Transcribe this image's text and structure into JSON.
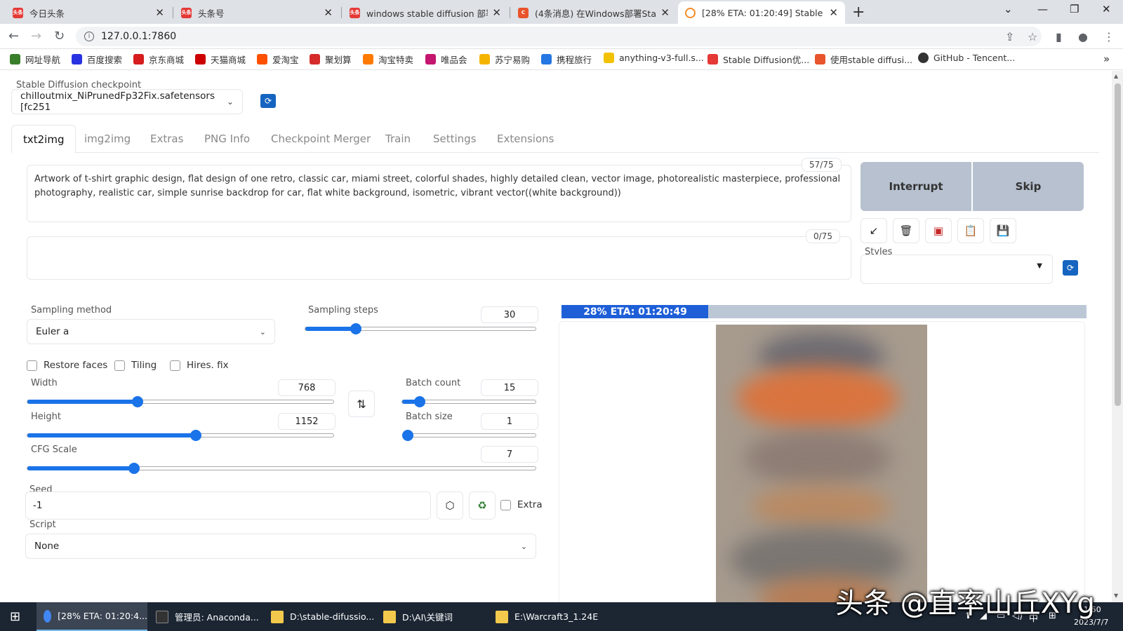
{
  "browser": {
    "tabs": [
      {
        "title": "今日头条",
        "icon_color": "#e53935",
        "icon_text": "头条"
      },
      {
        "title": "头条号",
        "icon_color": "#e53935",
        "icon_text": "头条"
      },
      {
        "title": "windows stable diffusion 部署",
        "icon_color": "#e53935",
        "icon_text": "头条"
      },
      {
        "title": "(4条消息) 在Windows部署Stabl",
        "icon_color": "#e8542c",
        "icon_text": "C"
      },
      {
        "title": "[28% ETA: 01:20:49] Stable Diff",
        "icon_color": "#f28c28",
        "icon_text": ""
      }
    ],
    "address": "127.0.0.1:7860",
    "bookmarks": [
      {
        "label": "网址导航",
        "color": "#3a7d2b"
      },
      {
        "label": "百度搜索",
        "color": "#2932e1"
      },
      {
        "label": "京东商城",
        "color": "#d71c1e"
      },
      {
        "label": "天猫商城",
        "color": "#cc0000"
      },
      {
        "label": "爱淘宝",
        "color": "#ff5000"
      },
      {
        "label": "聚划算",
        "color": "#d62b2b"
      },
      {
        "label": "淘宝特卖",
        "color": "#ff7a00"
      },
      {
        "label": "唯品会",
        "color": "#c5166f"
      },
      {
        "label": "苏宁易购",
        "color": "#f5b400"
      },
      {
        "label": "携程旅行",
        "color": "#2577e3"
      },
      {
        "label": "anything-v3-full.s...",
        "color": "#f2c200"
      },
      {
        "label": "Stable Diffusion优...",
        "color": "#e53935"
      },
      {
        "label": "使用stable diffusi...",
        "color": "#e8542c"
      },
      {
        "label": "GitHub - Tencent...",
        "color": "#333333"
      }
    ]
  },
  "app": {
    "checkpoint_label": "Stable Diffusion checkpoint",
    "checkpoint_value": "chilloutmix_NiPrunedFp32Fix.safetensors [fc251",
    "tabs": [
      "txt2img",
      "img2img",
      "Extras",
      "PNG Info",
      "Checkpoint Merger",
      "Train",
      "Settings",
      "Extensions"
    ],
    "prompt_text": "Artwork of t-shirt graphic design, flat design of one retro, classic car, miami street, colorful shades, highly detailed clean, vector image, photorealistic masterpiece, professional photography, realistic car, simple sunrise backdrop for car, flat white background, isometric, vibrant vector((white background))",
    "prompt_counter": "57/75",
    "negative_counter": "0/75",
    "interrupt_label": "Interrupt",
    "skip_label": "Skip",
    "tool_icons": [
      "arrow-icon",
      "trash-icon",
      "card-icon",
      "clipboard-icon",
      "save-icon"
    ],
    "styles_label": "Styles",
    "sampling_method_label": "Sampling method",
    "sampling_method_value": "Euler a",
    "sampling_steps_label": "Sampling steps",
    "sampling_steps_value": "30",
    "sampling_steps_fraction": 0.22,
    "restore_faces": "Restore faces",
    "tiling": "Tiling",
    "hires_fix": "Hires. fix",
    "width_label": "Width",
    "width_value": "768",
    "width_fraction": 0.36,
    "height_label": "Height",
    "height_value": "1152",
    "height_fraction": 0.55,
    "batch_count_label": "Batch count",
    "batch_count_value": "15",
    "batch_count_fraction": 0.13,
    "batch_size_label": "Batch size",
    "batch_size_value": "1",
    "batch_size_fraction": 0.0,
    "cfg_label": "CFG Scale",
    "cfg_value": "7",
    "cfg_fraction": 0.21,
    "seed_label": "Seed",
    "seed_value": "-1",
    "extra_label": "Extra",
    "script_label": "Script",
    "script_value": "None",
    "progress_text": "28% ETA: 01:20:49",
    "progress_fraction": 0.28
  },
  "taskbar": {
    "items": [
      {
        "label": "[28% ETA: 01:20:4...",
        "color": "#4285f4"
      },
      {
        "label": "管理员: Anaconda...",
        "color": "#333333"
      },
      {
        "label": "D:\\stable-difussio...",
        "color": "#f2c94c"
      },
      {
        "label": "D:\\AI\\关键词",
        "color": "#f2c94c"
      },
      {
        "label": "E:\\Warcraft3_1.24E",
        "color": "#f2c94c"
      }
    ],
    "ime": "中",
    "clock_time": "1:50",
    "clock_date": "2023/7/7"
  },
  "watermark": "头条 @直率山丘XYg"
}
